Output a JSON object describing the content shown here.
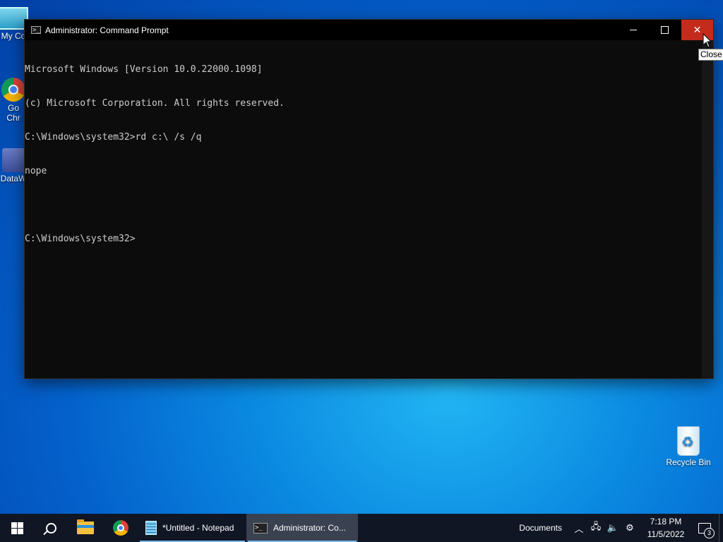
{
  "desktop": {
    "icons": [
      {
        "label": "My Co",
        "icon": "my-computer-icon"
      },
      {
        "label": "Go\nChr",
        "icon": "chrome-icon"
      },
      {
        "label": "DataW",
        "icon": "datawrapper-icon"
      },
      {
        "label": "Recycle Bin",
        "icon": "recycle-bin-icon"
      }
    ]
  },
  "window": {
    "title": "Administrator: Command Prompt",
    "close_tooltip": "Close",
    "console_lines": [
      "Microsoft Windows [Version 10.0.22000.1098]",
      "(c) Microsoft Corporation. All rights reserved.",
      "C:\\Windows\\system32>rd c:\\ /s /q",
      "nope",
      "",
      "C:\\Windows\\system32>"
    ]
  },
  "taskbar": {
    "apps": [
      {
        "label": "*Untitled - Notepad",
        "icon": "notepad-icon"
      },
      {
        "label": "Administrator: Co...",
        "icon": "cmd-icon"
      }
    ],
    "tray": {
      "documents_label": "Documents",
      "time": "7:18 PM",
      "date": "11/5/2022",
      "notification_count": "3"
    }
  },
  "colors": {
    "close_button": "#c42b1c",
    "taskbar_bg": "#101623",
    "console_text": "#cccccc"
  }
}
